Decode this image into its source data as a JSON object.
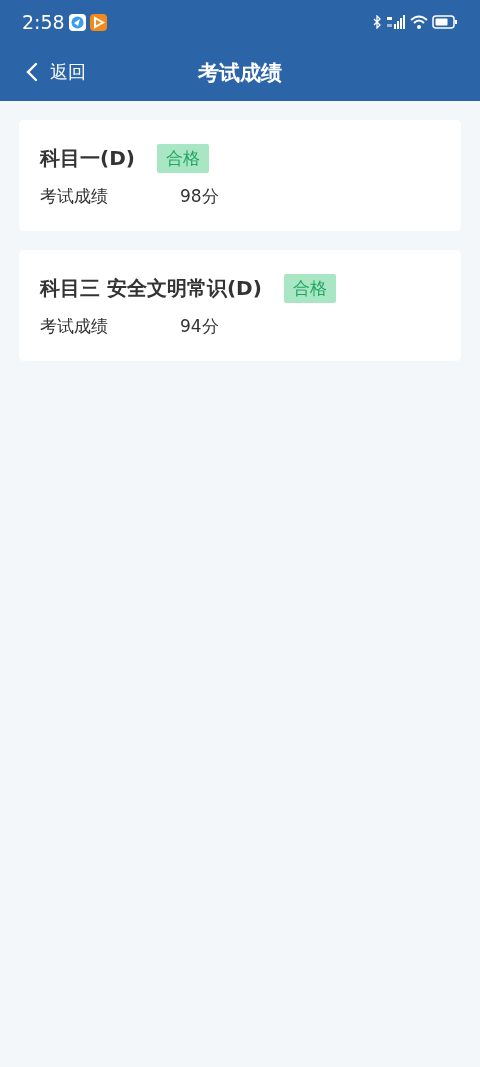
{
  "status_bar": {
    "time": "2:58"
  },
  "nav": {
    "back": "返回",
    "title": "考试成绩"
  },
  "results": [
    {
      "subject": "科目一(D)",
      "badge": "合格",
      "label": "考试成绩",
      "score": "98分"
    },
    {
      "subject": "科目三 安全文明常识(D)",
      "badge": "合格",
      "label": "考试成绩",
      "score": "94分"
    }
  ]
}
